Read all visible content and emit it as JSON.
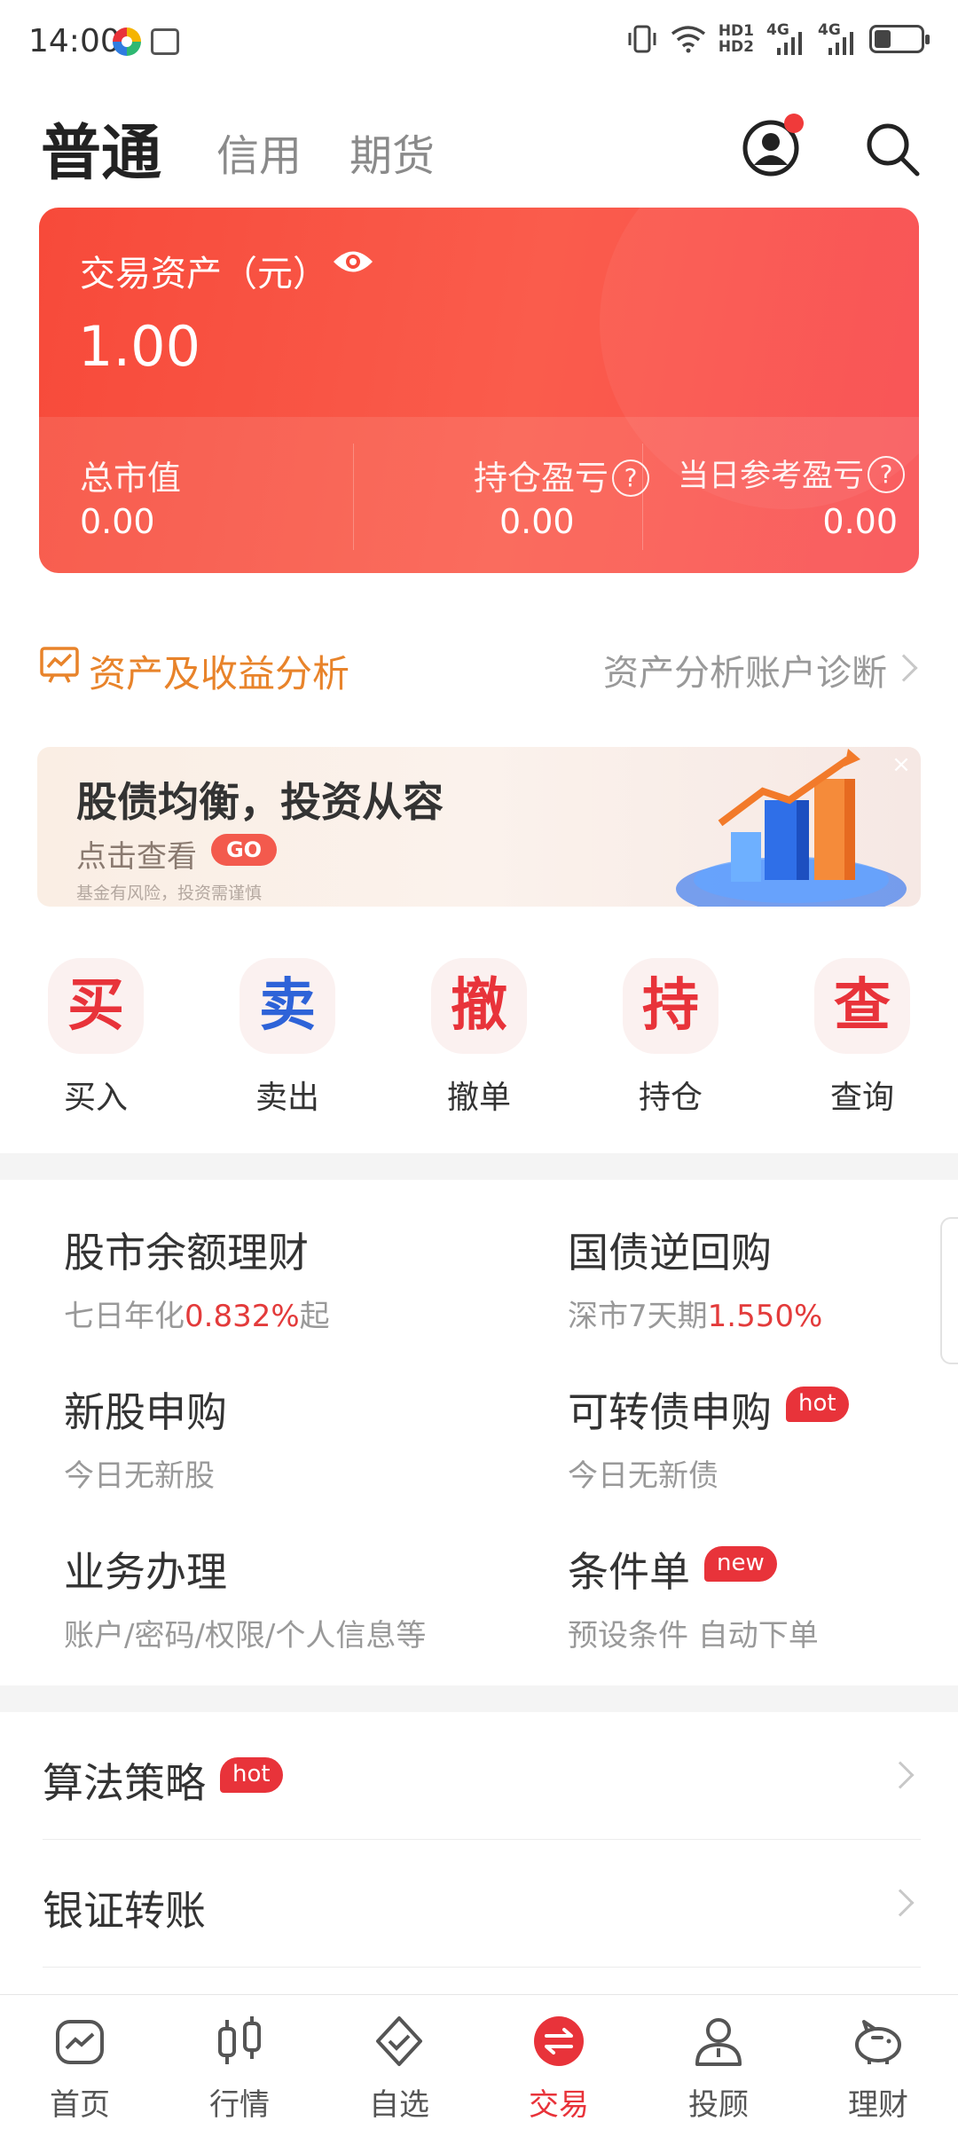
{
  "status_bar": {
    "time": "14:00",
    "hd_top": "HD1",
    "hd_bottom": "HD2",
    "net1": "4G",
    "net2": "4G"
  },
  "header": {
    "tabs": [
      {
        "label": "普通",
        "active": true
      },
      {
        "label": "信用",
        "active": false
      },
      {
        "label": "期货",
        "active": false
      }
    ]
  },
  "asset_card": {
    "title": "交易资产（元）",
    "value": "1.00",
    "stats": [
      {
        "label": "总市值",
        "value": "0.00",
        "help": false
      },
      {
        "label": "持仓盈亏",
        "value": "0.00",
        "help": true
      },
      {
        "label": "当日参考盈亏",
        "value": "0.00",
        "help": true
      }
    ],
    "help_glyph": "?"
  },
  "analysis": {
    "title": "资产及收益分析",
    "link": "资产分析账户诊断"
  },
  "banner": {
    "title": "股债均衡，投资从容",
    "subtitle": "点击查看",
    "go": "GO",
    "risk_note": "基金有风险，投资需谨慎",
    "close": "×"
  },
  "actions": [
    {
      "glyph": "买",
      "label": "买入",
      "color": "#e8333a"
    },
    {
      "glyph": "卖",
      "label": "卖出",
      "color": "#2e63d8"
    },
    {
      "glyph": "撤",
      "label": "撤单",
      "color": "#e8333a"
    },
    {
      "glyph": "持",
      "label": "持仓",
      "color": "#e8333a"
    },
    {
      "glyph": "查",
      "label": "查询",
      "color": "#e8333a"
    }
  ],
  "services": [
    {
      "title": "股市余额理财",
      "sub_prefix": "七日年化",
      "sub_highlight": "0.832%",
      "sub_suffix": "起"
    },
    {
      "title": "国债逆回购",
      "sub_prefix": "深市7天期",
      "sub_highlight": "1.550%",
      "sub_suffix": ""
    },
    {
      "title": "新股申购",
      "sub_prefix": "今日无新股",
      "sub_highlight": "",
      "sub_suffix": ""
    },
    {
      "title": "可转债申购",
      "badge": "hot",
      "sub_prefix": "今日无新债",
      "sub_highlight": "",
      "sub_suffix": ""
    },
    {
      "title": "业务办理",
      "sub_prefix": "账户/密码/权限/个人信息等",
      "sub_highlight": "",
      "sub_suffix": ""
    },
    {
      "title": "条件单",
      "badge": "new",
      "sub_prefix": "预设条件 自动下单",
      "sub_highlight": "",
      "sub_suffix": ""
    }
  ],
  "list": [
    {
      "label": "算法策略",
      "badge": "hot"
    },
    {
      "label": "银证转账"
    }
  ],
  "bottom_nav": [
    {
      "label": "首页",
      "icon": "home-chart-icon",
      "active": false
    },
    {
      "label": "行情",
      "icon": "candlestick-icon",
      "active": false
    },
    {
      "label": "自选",
      "icon": "shield-check-icon",
      "active": false
    },
    {
      "label": "交易",
      "icon": "exchange-icon",
      "active": true
    },
    {
      "label": "投顾",
      "icon": "advisor-icon",
      "active": false
    },
    {
      "label": "理财",
      "icon": "piggy-bank-icon",
      "active": false
    }
  ],
  "colors": {
    "accent_red": "#e8333a",
    "card_red": "#f74a3a",
    "analysis_orange": "#e8832a",
    "sell_blue": "#2e63d8"
  }
}
